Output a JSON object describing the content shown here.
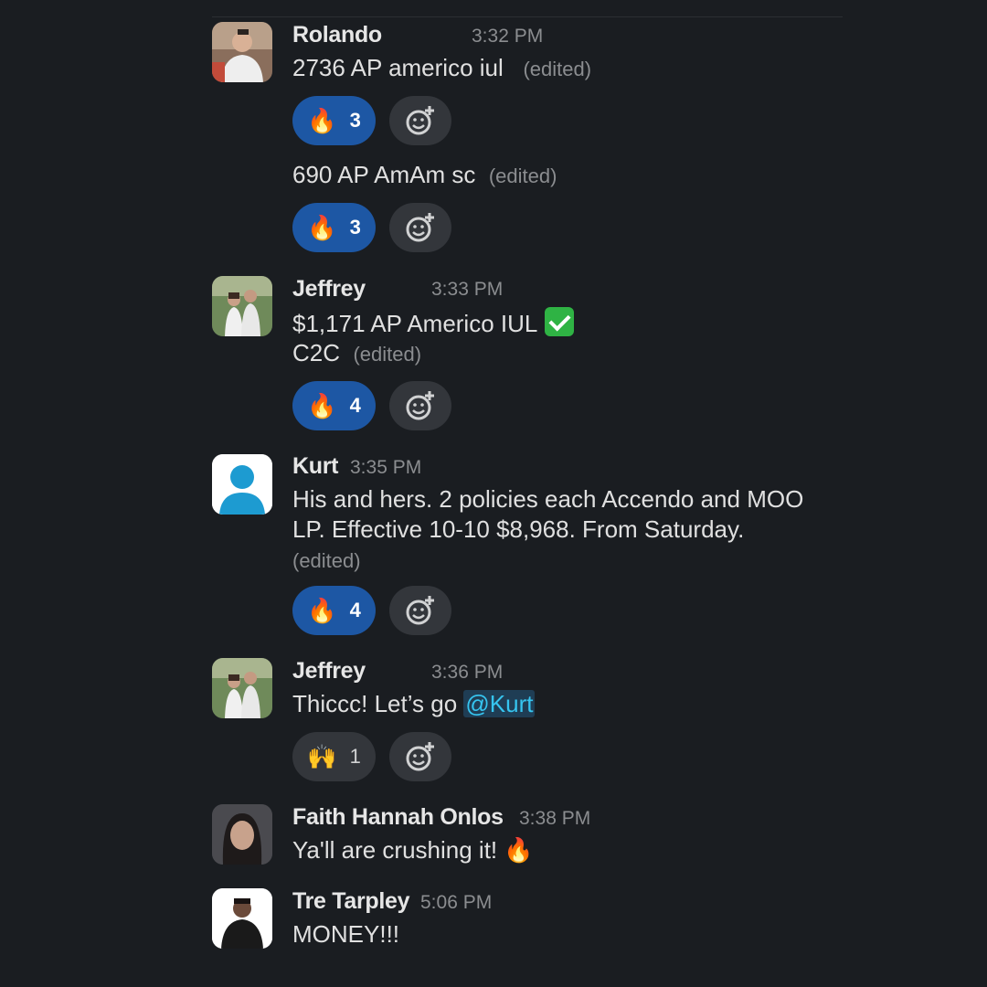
{
  "colors": {
    "background": "#1a1d21",
    "reaction_active": "#1d57a4",
    "reaction_idle": "#33363b",
    "mention": "#36c5f0",
    "check": "#2fb344"
  },
  "messages": [
    {
      "author": "Rolando",
      "time": "3:32 PM",
      "avatar": "person-photo",
      "lines": [
        {
          "text": "2736 AP americo iul",
          "edited": "(edited)",
          "reaction": {
            "emoji": "🔥",
            "count": "3"
          }
        },
        {
          "text": "690 AP AmAm sc",
          "edited": "(edited)",
          "reaction": {
            "emoji": "🔥",
            "count": "3"
          }
        }
      ]
    },
    {
      "author": "Jeffrey",
      "time": "3:33 PM",
      "avatar": "couple-photo",
      "text_line1": "$1,171 AP Americo IUL",
      "check_icon": "white-check-mark-icon",
      "text_line2": "C2C",
      "edited": "(edited)",
      "reaction": {
        "emoji": "🔥",
        "count": "4"
      }
    },
    {
      "author": "Kurt",
      "time": "3:35 PM",
      "avatar": "default-user-icon",
      "text": "His and hers. 2 policies each Accendo and MOO LP. Effective 10-10 $8,968. From Saturday.",
      "edited": "(edited)",
      "reaction": {
        "emoji": "🔥",
        "count": "4"
      }
    },
    {
      "author": "Jeffrey",
      "time": "3:36 PM",
      "avatar": "couple-photo",
      "text": "Thiccc! Let’s go",
      "mention": "@Kurt",
      "reaction": {
        "emoji": "🙌",
        "count": "1"
      }
    },
    {
      "author": "Faith Hannah Onlos",
      "time": "3:38 PM",
      "avatar": "person-photo",
      "text": "Ya'll are crushing it!",
      "emoji": "🔥"
    },
    {
      "author": "Tre Tarpley",
      "time": "5:06 PM",
      "avatar": "person-photo",
      "text": "MONEY!!!"
    }
  ]
}
